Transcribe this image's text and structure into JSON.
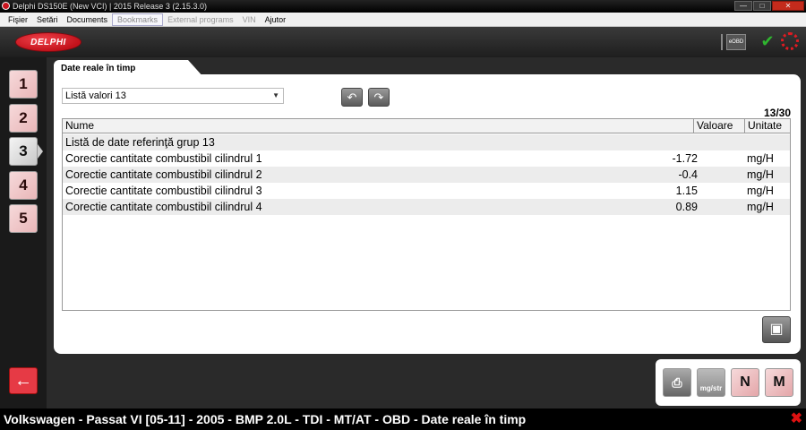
{
  "window": {
    "title": "Delphi DS150E (New VCI) | 2015 Release 3 (2.15.3.0)"
  },
  "menu": [
    {
      "label": "Fişier",
      "state": "normal"
    },
    {
      "label": "Setări",
      "state": "normal"
    },
    {
      "label": "Documents",
      "state": "normal"
    },
    {
      "label": "Bookmarks",
      "state": "active"
    },
    {
      "label": "External programs",
      "state": "disabled"
    },
    {
      "label": "VIN",
      "state": "disabled"
    },
    {
      "label": "Ajutor",
      "state": "normal"
    }
  ],
  "header": {
    "logo_text": "DELPHI",
    "eobd_label": "eOBD"
  },
  "steps": [
    "1",
    "2",
    "3",
    "4",
    "5"
  ],
  "active_step": "3",
  "tab": {
    "label": "Date reale în timp"
  },
  "selector": {
    "value": "Listă valori 13"
  },
  "page_count": "13/30",
  "grid": {
    "columns": [
      "Nume",
      "Valoare",
      "Unitate"
    ],
    "rows": [
      {
        "name": "Listă de date referinţă grup 13",
        "value": "",
        "unit": ""
      },
      {
        "name": "Corectie cantitate combustibil cilindrul 1",
        "value": "-1.72",
        "unit": "mg/H"
      },
      {
        "name": "Corectie cantitate combustibil cilindrul 2",
        "value": "-0.4",
        "unit": "mg/H"
      },
      {
        "name": "Corectie cantitate combustibil cilindrul 3",
        "value": "1.15",
        "unit": "mg/H"
      },
      {
        "name": "Corectie cantitate combustibil cilindrul 4",
        "value": "0.89",
        "unit": "mg/H"
      }
    ]
  },
  "tools": {
    "units_label": "mg/str",
    "n_label": "N",
    "m_label": "M"
  },
  "status": {
    "text": "Volkswagen - Passat VI [05-11] - 2005 - BMP 2.0L - TDI - MT/AT - OBD - Date reale în timp"
  },
  "colors": {
    "accent_red": "#c9141e",
    "ok_green": "#2fb52f"
  }
}
